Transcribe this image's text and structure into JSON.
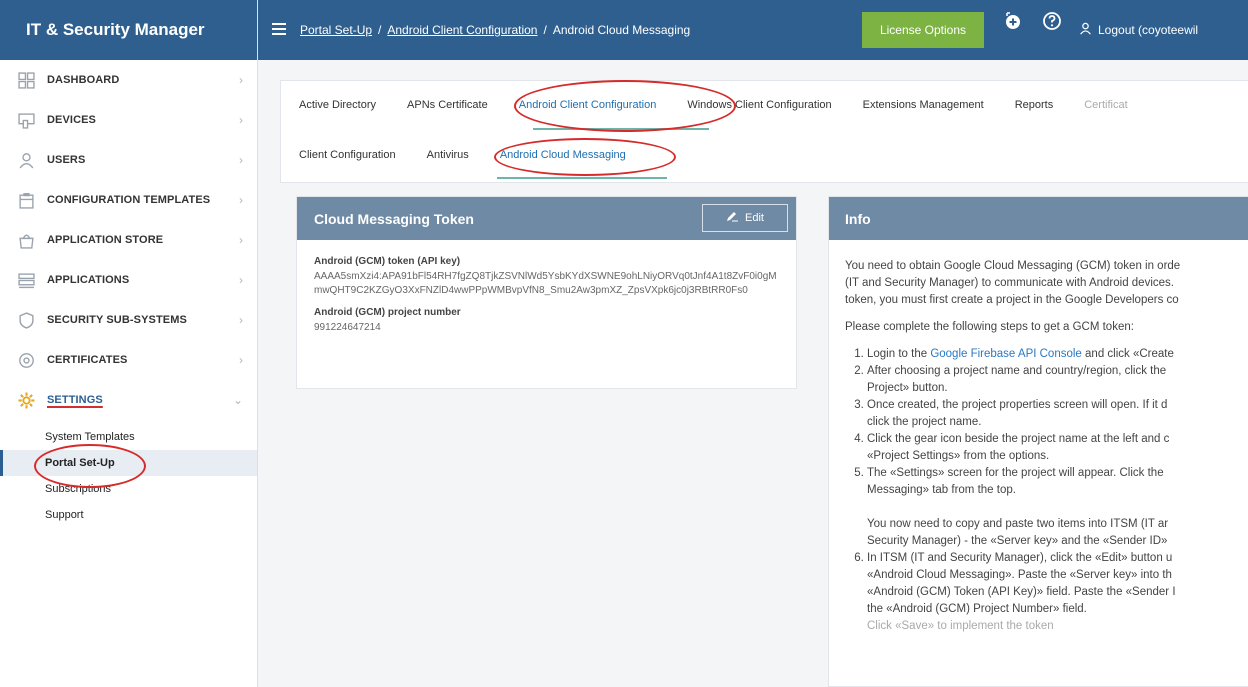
{
  "app": {
    "title": "IT & Security Manager"
  },
  "sidebar": {
    "items": [
      {
        "label": "DASHBOARD",
        "icon": "dashboard-icon"
      },
      {
        "label": "DEVICES",
        "icon": "devices-icon"
      },
      {
        "label": "USERS",
        "icon": "users-icon"
      },
      {
        "label": "CONFIGURATION TEMPLATES",
        "icon": "templates-icon"
      },
      {
        "label": "APPLICATION STORE",
        "icon": "store-icon"
      },
      {
        "label": "APPLICATIONS",
        "icon": "applications-icon"
      },
      {
        "label": "SECURITY SUB-SYSTEMS",
        "icon": "shield-icon"
      },
      {
        "label": "CERTIFICATES",
        "icon": "certificate-icon"
      },
      {
        "label": "SETTINGS",
        "icon": "gear-icon"
      }
    ],
    "settings_sub": [
      {
        "label": "System Templates"
      },
      {
        "label": "Portal Set-Up"
      },
      {
        "label": "Subscriptions"
      },
      {
        "label": "Support"
      }
    ]
  },
  "header": {
    "breadcrumb": [
      "Portal Set-Up",
      "Android Client Configuration",
      "Android Cloud Messaging"
    ],
    "separator": "/",
    "license_button": "License Options",
    "logout": "Logout (coyoteewil"
  },
  "tabs": {
    "main": [
      "Active Directory",
      "APNs Certificate",
      "Android Client Configuration",
      "Windows Client Configuration",
      "Extensions Management",
      "Reports",
      "Certificat"
    ],
    "sub": [
      "Client Configuration",
      "Antivirus",
      "Android Cloud Messaging"
    ]
  },
  "token_card": {
    "title": "Cloud Messaging Token",
    "edit_label": "Edit",
    "token_label": "Android (GCM) token (API key)",
    "token_value": "AAAA5smXzi4:APA91bFl54RH7fgZQ8TjkZSVNlWd5YsbKYdXSWNE9ohLNiyORVq0tJnf4A1t8ZvF0i0gMmwQHT9C2KZGyO3XxFNZlD4wwPPpWMBvpVfN8_Smu2Aw3pmXZ_ZpsVXpk6jc0j3RBtRR0Fs0",
    "project_label": "Android (GCM) project number",
    "project_value": "991224647214"
  },
  "info_card": {
    "title": "Info",
    "intro": [
      "You need to obtain Google Cloud Messaging (GCM) token in orde",
      "(IT and Security Manager) to communicate with Android devices.",
      "token, you must first create a project in the Google Developers co"
    ],
    "steps_intro": "Please complete the following steps to get a GCM token:",
    "steps": [
      {
        "num": "1.",
        "lines": [
          "Login to the ",
          "Google Firebase API Console",
          " and click «Create"
        ]
      },
      {
        "num": "2.",
        "lines": [
          "After choosing a project name and country/region, click the",
          "Project» button."
        ]
      },
      {
        "num": "3.",
        "lines": [
          "Once created, the project properties screen will open. If it d",
          "click the project name."
        ]
      },
      {
        "num": "4.",
        "lines": [
          "Click the gear icon beside the project name at the left and c",
          "«Project Settings» from the options."
        ]
      },
      {
        "num": "5.",
        "lines": [
          "The «Settings» screen for the project will appear. Click the",
          "Messaging» tab from the top."
        ]
      }
    ],
    "copy_note": [
      "You now need to copy and paste two items into ITSM (IT ar",
      "Security Manager) - the «Server key» and the «Sender ID»"
    ],
    "step6": {
      "num": "6.",
      "lines": [
        "In ITSM (IT and Security Manager), click the «Edit» button u",
        "«Android Cloud Messaging». Paste the «Server key» into th",
        "«Android (GCM) Token (API Key)» field. Paste the «Sender I",
        "the «Android (GCM) Project Number» field.",
        "Click «Save» to implement the token"
      ]
    }
  },
  "colors": {
    "header_bg": "#2f5f8f",
    "license_green": "#7cb342",
    "card_header": "#6f8aa5",
    "annotation_red": "#d62b2b",
    "active_tab": "#1e6fb0"
  }
}
